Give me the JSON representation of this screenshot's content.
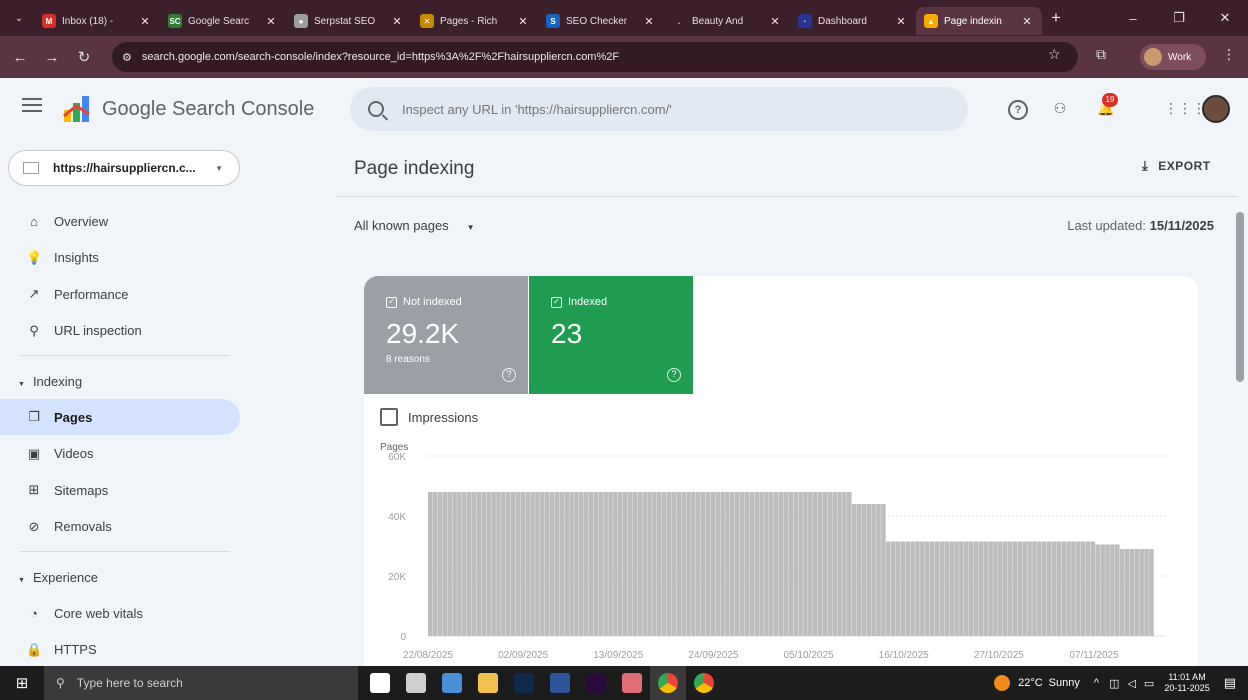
{
  "browser": {
    "tabs": [
      {
        "label": "Inbox (18) - ",
        "fav_color": "#d93025",
        "fav_glyph": "M"
      },
      {
        "label": "Google Searc",
        "fav_color": "#2e7d32",
        "fav_glyph": "SC"
      },
      {
        "label": "Serpstat SEO",
        "fav_color": "#9e9e9e",
        "fav_glyph": "●"
      },
      {
        "label": "Pages - Rich",
        "fav_color": "#c58b00",
        "fav_glyph": "✕"
      },
      {
        "label": "SEO Checker",
        "fav_color": "#1565c0",
        "fav_glyph": "S"
      },
      {
        "label": "Beauty And",
        "fav_color": "#3b1f2b",
        "fav_glyph": "."
      },
      {
        "label": "Dashboard",
        "fav_color": "#283593",
        "fav_glyph": "·"
      },
      {
        "label": "Page indexin",
        "fav_color": "#f9ab00",
        "fav_glyph": "▲",
        "active": true
      }
    ],
    "url": "search.google.com/search-console/index?resource_id=https%3A%2F%2Fhairsuppliercn.com%2F",
    "profile_label": "Work"
  },
  "header": {
    "app_title": "Google Search Console",
    "search_placeholder": "Inspect any URL in 'https://hairsuppliercn.com/'",
    "notification_count": "19"
  },
  "sidebar": {
    "property": "https://hairsuppliercn.c...",
    "items_top": [
      {
        "label": "Overview",
        "icon": "home-icon",
        "glyph": "⌂"
      },
      {
        "label": "Insights",
        "icon": "lightbulb-icon",
        "glyph": "💡"
      },
      {
        "label": "Performance",
        "icon": "trending-icon",
        "glyph": "↗"
      },
      {
        "label": "URL inspection",
        "icon": "search-icon",
        "glyph": "⚲"
      }
    ],
    "section_indexing": "Indexing",
    "items_indexing": [
      {
        "label": "Pages",
        "icon": "pages-icon",
        "glyph": "❐",
        "selected": true
      },
      {
        "label": "Videos",
        "icon": "video-icon",
        "glyph": "▣"
      },
      {
        "label": "Sitemaps",
        "icon": "sitemap-icon",
        "glyph": "⊞"
      },
      {
        "label": "Removals",
        "icon": "removals-icon",
        "glyph": "⊘"
      }
    ],
    "section_experience": "Experience",
    "items_experience": [
      {
        "label": "Core web vitals",
        "icon": "gauge-icon",
        "glyph": "◔"
      },
      {
        "label": "HTTPS",
        "icon": "lock-icon",
        "glyph": "🔒"
      }
    ]
  },
  "main": {
    "title": "Page indexing",
    "export_label": "EXPORT",
    "filter_label": "All known pages",
    "last_updated_label": "Last updated:",
    "last_updated_value": "15/11/2025",
    "tiles": {
      "not_indexed": {
        "label": "Not indexed",
        "value": "29.2K",
        "sub": "8 reasons",
        "color": "#9aa0a6"
      },
      "indexed": {
        "label": "Indexed",
        "value": "23",
        "color": "#1e9d50"
      }
    },
    "impressions_label": "Impressions"
  },
  "chart_data": {
    "type": "bar",
    "ylabel": "Pages",
    "ylim": [
      0,
      60000
    ],
    "yticks": [
      "60K",
      "40K",
      "20K",
      "0"
    ],
    "xticks": [
      "22/08/2025",
      "02/09/2025",
      "13/09/2025",
      "24/09/2025",
      "05/10/2025",
      "16/10/2025",
      "27/10/2025",
      "07/11/2025"
    ],
    "bar_color": "#bdbdbd",
    "values": [
      48000,
      48000,
      48000,
      48000,
      48000,
      48000,
      48000,
      48000,
      48000,
      48000,
      48000,
      48000,
      48000,
      48000,
      48000,
      48000,
      48000,
      48000,
      48000,
      48000,
      48000,
      48000,
      48000,
      48000,
      48000,
      48000,
      48000,
      48000,
      48000,
      48000,
      48000,
      48000,
      48000,
      48000,
      48000,
      48000,
      48000,
      48000,
      48000,
      48000,
      48000,
      48000,
      48000,
      48000,
      48000,
      48000,
      48000,
      48000,
      48000,
      48000,
      48000,
      48000,
      48000,
      48000,
      48000,
      48000,
      48000,
      48000,
      48000,
      48000,
      48000,
      48000,
      48000,
      48000,
      48000,
      48000,
      48000,
      48000,
      48000,
      48000,
      48000,
      48000,
      48000,
      48000,
      48000,
      48000,
      48000,
      48000,
      48000,
      48000,
      48000,
      48000,
      48000,
      48000,
      48000,
      48000,
      48000,
      44000,
      44000,
      44000,
      44000,
      44000,
      44000,
      44000,
      31500,
      31500,
      31500,
      31500,
      31500,
      31500,
      31500,
      31500,
      31500,
      31500,
      31500,
      31500,
      31500,
      31500,
      31500,
      31500,
      31500,
      31500,
      31500,
      31500,
      31500,
      31500,
      31500,
      31500,
      31500,
      31500,
      31500,
      31500,
      31500,
      31500,
      31500,
      31500,
      31500,
      31500,
      31500,
      31500,
      31500,
      31500,
      31500,
      31500,
      31500,
      31500,
      31500,
      30500,
      30500,
      30500,
      30500,
      30500,
      29000,
      29000,
      29000,
      29000,
      29000,
      29000,
      29000
    ]
  },
  "taskbar": {
    "search_placeholder": "Type here to search",
    "apps": [
      {
        "name": "task-view-icon",
        "color": "#ffffff"
      },
      {
        "name": "widgets-icon",
        "color": "#cfcfcf"
      },
      {
        "name": "notepad-icon",
        "color": "#4a90d9"
      },
      {
        "name": "file-explorer-icon",
        "color": "#f2c14e"
      },
      {
        "name": "photoshop-icon",
        "color": "#0f2a4a"
      },
      {
        "name": "word-icon",
        "color": "#2b579a"
      },
      {
        "name": "premiere-icon",
        "color": "#2a0a3a"
      },
      {
        "name": "paint-icon",
        "color": "#e06c75"
      },
      {
        "name": "chrome-icon",
        "color": "#34a853",
        "active": true
      },
      {
        "name": "chrome-icon",
        "color": "#ea4335"
      }
    ],
    "weather_temp": "22°C",
    "weather_text": "Sunny",
    "time": "11:01 AM",
    "date": "20-11-2025"
  }
}
